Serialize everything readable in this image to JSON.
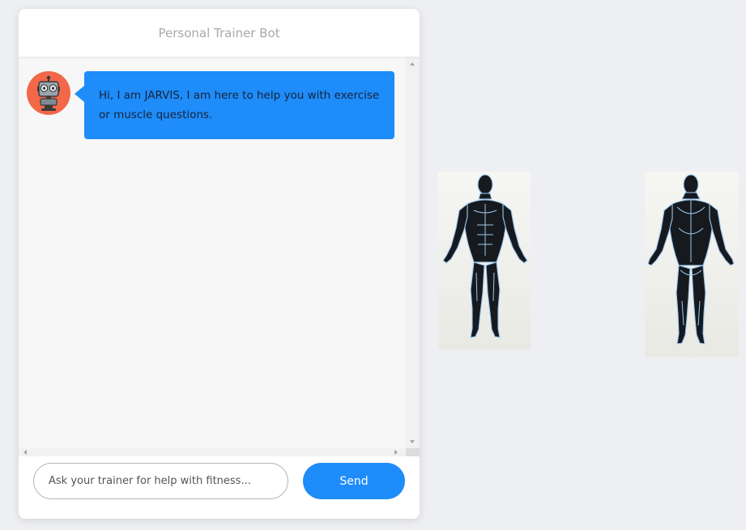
{
  "header": {
    "title": "Personal Trainer Bot"
  },
  "messages": [
    {
      "sender": "bot",
      "avatar_icon": "robot-icon",
      "text": "Hi, I am JARVIS, I am here to help you with exercise or muscle questions."
    }
  ],
  "composer": {
    "placeholder": "Ask your trainer for help with fitness...",
    "value": "",
    "send_label": "Send"
  },
  "anatomy": {
    "front_icon": "muscle-anatomy-front-icon",
    "back_icon": "muscle-anatomy-back-icon"
  },
  "colors": {
    "accent": "#1e8cf9",
    "avatar_bg": "#f26849",
    "page_bg": "#eeeff2",
    "chat_bg": "#f7f7f7"
  }
}
